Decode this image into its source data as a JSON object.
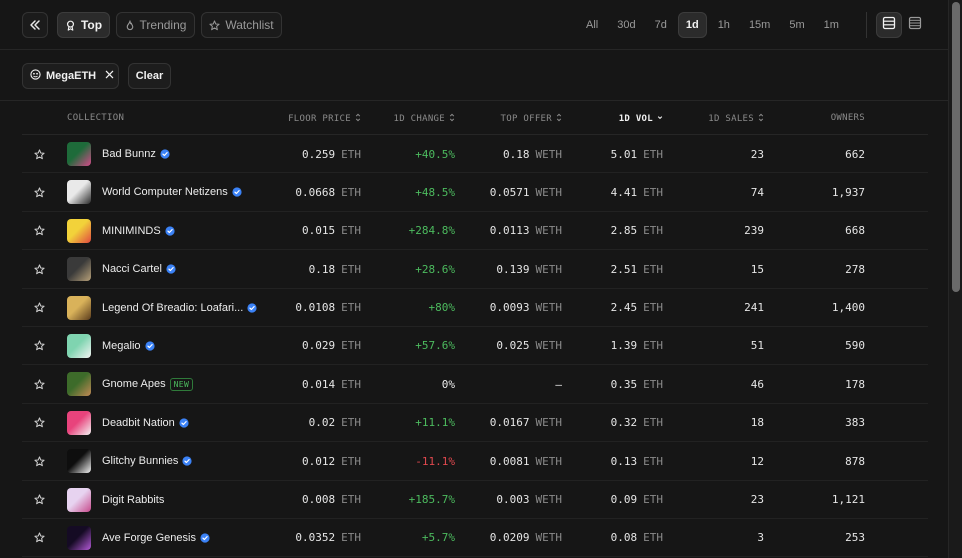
{
  "header": {
    "tabs": [
      {
        "label": "Top",
        "icon": "trophy-icon",
        "active": true
      },
      {
        "label": "Trending",
        "icon": "flame-icon",
        "active": false
      },
      {
        "label": "Watchlist",
        "icon": "star-icon",
        "active": false
      }
    ],
    "time_filters": [
      {
        "label": "All",
        "active": false
      },
      {
        "label": "30d",
        "active": false
      },
      {
        "label": "7d",
        "active": false
      },
      {
        "label": "1d",
        "active": true
      },
      {
        "label": "1h",
        "active": false
      },
      {
        "label": "15m",
        "active": false
      },
      {
        "label": "5m",
        "active": false
      },
      {
        "label": "1m",
        "active": false
      }
    ],
    "view_modes": [
      {
        "icon": "list-view-icon",
        "active": true
      },
      {
        "icon": "compact-view-icon",
        "active": false
      }
    ]
  },
  "filters": {
    "chip_label": "MegaETH",
    "clear_label": "Clear"
  },
  "table": {
    "columns": {
      "collection": "COLLECTION",
      "floor": "FLOOR PRICE",
      "change": "1D CHANGE",
      "offer": "TOP OFFER",
      "volume": "1D VOL",
      "sales": "1D SALES",
      "owners": "OWNERS"
    },
    "sorted_column": "volume",
    "rows": [
      {
        "name": "Bad Bunnz",
        "verified": true,
        "floor": "0.259",
        "floor_unit": "ETH",
        "change": "+40.5%",
        "change_dir": "pos",
        "offer": "0.18",
        "offer_unit": "WETH",
        "volume": "5.01",
        "volume_unit": "ETH",
        "sales": "23",
        "owners": "662",
        "thumb_colors": [
          "#1e6b3a",
          "#d44b8a"
        ]
      },
      {
        "name": "World Computer Netizens",
        "verified": true,
        "floor": "0.0668",
        "floor_unit": "ETH",
        "change": "+48.5%",
        "change_dir": "pos",
        "offer": "0.0571",
        "offer_unit": "WETH",
        "volume": "4.41",
        "volume_unit": "ETH",
        "sales": "74",
        "owners": "1,937",
        "thumb_colors": [
          "#e9e9e9",
          "#2a2a2a"
        ]
      },
      {
        "name": "MINIMINDS",
        "verified": true,
        "floor": "0.015",
        "floor_unit": "ETH",
        "change": "+284.8%",
        "change_dir": "pos",
        "offer": "0.0113",
        "offer_unit": "WETH",
        "volume": "2.85",
        "volume_unit": "ETH",
        "sales": "239",
        "owners": "668",
        "thumb_colors": [
          "#f2d23a",
          "#e0483f"
        ]
      },
      {
        "name": "Nacci Cartel",
        "verified": true,
        "floor": "0.18",
        "floor_unit": "ETH",
        "change": "+28.6%",
        "change_dir": "pos",
        "offer": "0.139",
        "offer_unit": "WETH",
        "volume": "2.51",
        "volume_unit": "ETH",
        "sales": "15",
        "owners": "278",
        "thumb_colors": [
          "#3a3a3a",
          "#b8a27a"
        ]
      },
      {
        "name": "Legend Of Breadio: Loafari...",
        "verified": true,
        "floor": "0.0108",
        "floor_unit": "ETH",
        "change": "+80%",
        "change_dir": "pos",
        "offer": "0.0093",
        "offer_unit": "WETH",
        "volume": "2.45",
        "volume_unit": "ETH",
        "sales": "241",
        "owners": "1,400",
        "thumb_colors": [
          "#d9b25a",
          "#5a3b1c"
        ]
      },
      {
        "name": "Megalio",
        "verified": true,
        "floor": "0.029",
        "floor_unit": "ETH",
        "change": "+57.6%",
        "change_dir": "pos",
        "offer": "0.025",
        "offer_unit": "WETH",
        "volume": "1.39",
        "volume_unit": "ETH",
        "sales": "51",
        "owners": "590",
        "thumb_colors": [
          "#7fd4b0",
          "#f4f4f4"
        ]
      },
      {
        "name": "Gnome Apes",
        "verified": false,
        "badge": "NEW",
        "floor": "0.014",
        "floor_unit": "ETH",
        "change": "0%",
        "change_dir": "neutral",
        "offer": "–",
        "offer_unit": "",
        "volume": "0.35",
        "volume_unit": "ETH",
        "sales": "46",
        "owners": "178",
        "thumb_colors": [
          "#3d6b2a",
          "#c28a55"
        ]
      },
      {
        "name": "Deadbit Nation",
        "verified": true,
        "floor": "0.02",
        "floor_unit": "ETH",
        "change": "+11.1%",
        "change_dir": "pos",
        "offer": "0.0167",
        "offer_unit": "WETH",
        "volume": "0.32",
        "volume_unit": "ETH",
        "sales": "18",
        "owners": "383",
        "thumb_colors": [
          "#e8437c",
          "#f4f4f4"
        ]
      },
      {
        "name": "Glitchy Bunnies",
        "verified": true,
        "floor": "0.012",
        "floor_unit": "ETH",
        "change": "-11.1%",
        "change_dir": "neg",
        "offer": "0.0081",
        "offer_unit": "WETH",
        "volume": "0.13",
        "volume_unit": "ETH",
        "sales": "12",
        "owners": "878",
        "thumb_colors": [
          "#0e0e0e",
          "#f4f4f4"
        ]
      },
      {
        "name": "Digit Rabbits",
        "verified": false,
        "floor": "0.008",
        "floor_unit": "ETH",
        "change": "+185.7%",
        "change_dir": "pos",
        "offer": "0.003",
        "offer_unit": "WETH",
        "volume": "0.09",
        "volume_unit": "ETH",
        "sales": "23",
        "owners": "1,121",
        "thumb_colors": [
          "#e7d3f0",
          "#c74a8c"
        ]
      },
      {
        "name": "Ave Forge Genesis",
        "verified": true,
        "floor": "0.0352",
        "floor_unit": "ETH",
        "change": "+5.7%",
        "change_dir": "pos",
        "offer": "0.0209",
        "offer_unit": "WETH",
        "volume": "0.08",
        "volume_unit": "ETH",
        "sales": "3",
        "owners": "253",
        "thumb_colors": [
          "#150b24",
          "#b45ad8"
        ]
      }
    ]
  },
  "colors": {
    "positive": "#4cbb5e",
    "negative": "#e0484e",
    "verified": "#3b82f6"
  }
}
